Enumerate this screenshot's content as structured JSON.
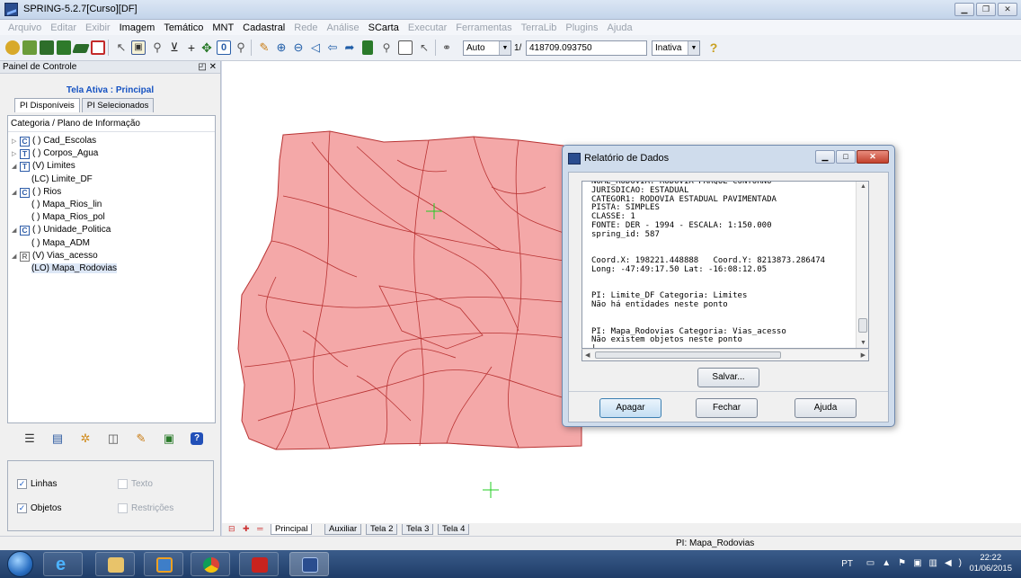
{
  "window": {
    "title": "SPRING-5.2.7[Curso][DF]"
  },
  "menu": [
    {
      "label": "Arquivo",
      "enabled": false
    },
    {
      "label": "Editar",
      "enabled": false
    },
    {
      "label": "Exibir",
      "enabled": false
    },
    {
      "label": "Imagem",
      "enabled": true
    },
    {
      "label": "Temático",
      "enabled": true
    },
    {
      "label": "MNT",
      "enabled": true
    },
    {
      "label": "Cadastral",
      "enabled": true
    },
    {
      "label": "Rede",
      "enabled": false
    },
    {
      "label": "Análise",
      "enabled": false
    },
    {
      "label": "SCarta",
      "enabled": true
    },
    {
      "label": "Executar",
      "enabled": false
    },
    {
      "label": "Ferramentas",
      "enabled": false
    },
    {
      "label": "TerraLib",
      "enabled": false
    },
    {
      "label": "Plugins",
      "enabled": false
    },
    {
      "label": "Ajuda",
      "enabled": false
    }
  ],
  "toolbar": {
    "zoom_mode": "Auto",
    "scale_prefix": "1/",
    "scale_value": "418709.093750",
    "state": "Inativa",
    "help_glyph": "?"
  },
  "panel": {
    "title": "Painel de Controle",
    "close_glyph": "✕",
    "active_screen": "Tela Ativa : Principal",
    "tabs": [
      "PI Disponíveis",
      "PI Selecionados"
    ],
    "tree_header": "Categoria / Plano de Informação",
    "tree": [
      {
        "type": "C",
        "label": "( ) Cad_Escolas"
      },
      {
        "type": "T",
        "label": "( ) Corpos_Agua"
      },
      {
        "type": "T",
        "label": "(V) Limites"
      },
      {
        "type": "",
        "label": "(LC) Limite_DF"
      },
      {
        "type": "C",
        "label": "( ) Rios"
      },
      {
        "type": "",
        "label": "( ) Mapa_Rios_lin"
      },
      {
        "type": "",
        "label": "( ) Mapa_Rios_pol"
      },
      {
        "type": "C",
        "label": "( ) Unidade_Politica"
      },
      {
        "type": "",
        "label": "( ) Mapa_ADM"
      },
      {
        "type": "R",
        "label": "(V) Vias_acesso"
      },
      {
        "type": "",
        "label": "(LO) Mapa_Rodovias"
      }
    ],
    "options": {
      "lines": {
        "label": "Linhas",
        "checked": true
      },
      "text": {
        "label": "Texto",
        "checked": false
      },
      "objects": {
        "label": "Objetos",
        "checked": true
      },
      "restrictions": {
        "label": "Restrições",
        "checked": false
      }
    }
  },
  "sheets": {
    "nav": "⊟ ✚ ═ »",
    "tabs": [
      "Principal",
      "Auxiliar",
      "Tela 2",
      "Tela 3",
      "Tela 4"
    ],
    "active": "Principal"
  },
  "status": {
    "pi": "PI: Mapa_Rodovias"
  },
  "dialog": {
    "title": "Relatório de Dados",
    "report_lines": [
      "NOME_RODOVIA: RODOVIA PARQUE CONTORNO",
      "JURISDICAO: ESTADUAL",
      "CATEGOR1: RODOVIA ESTADUAL PAVIMENTADA",
      "PISTA: SIMPLES",
      "CLASSE: 1",
      "FONTE: DER - 1994 - ESCALA: 1:150.000",
      "spring_id: 587",
      "",
      "",
      "Coord.X: 198221.448888   Coord.Y: 8213873.286474",
      "Long: -47:49:17.50 Lat: -16:08:12.05",
      "",
      "",
      "PI: Limite_DF Categoria: Limites",
      "Não há entidades neste ponto",
      "",
      "",
      "PI: Mapa_Rodovias Categoria: Vias_acesso",
      "Não existem objetos neste ponto",
      "|"
    ],
    "save_label": "Salvar...",
    "clear_label": "Apagar",
    "close_label": "Fechar",
    "help_label": "Ajuda"
  },
  "taskbar": {
    "language": "PT",
    "time": "22:22",
    "date": "01/06/2015"
  },
  "colors": {
    "map_fill": "#f4a8a8",
    "map_stroke": "#b83232",
    "cursor": "#22cc22",
    "accent": "#1552c2"
  }
}
